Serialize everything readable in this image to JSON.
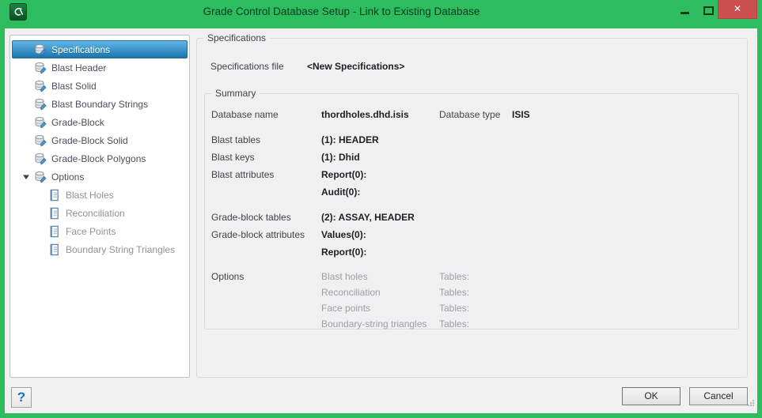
{
  "window": {
    "title": "Grade Control Database Setup - Link to Existing Database",
    "close_glyph": "✕"
  },
  "sidebar": {
    "items": [
      {
        "label": "Specifications",
        "icon": "database-edit",
        "selected": true
      },
      {
        "label": "Blast Header",
        "icon": "database-edit"
      },
      {
        "label": "Blast Solid",
        "icon": "database-edit"
      },
      {
        "label": "Blast Boundary Strings",
        "icon": "database-edit"
      },
      {
        "label": "Grade-Block",
        "icon": "database-edit"
      },
      {
        "label": "Grade-Block Solid",
        "icon": "database-edit"
      },
      {
        "label": "Grade-Block Polygons",
        "icon": "database-edit"
      },
      {
        "label": "Options",
        "icon": "database-edit",
        "expanded": true
      },
      {
        "label": "Blast Holes",
        "icon": "document",
        "child": true
      },
      {
        "label": "Reconciliation",
        "icon": "document",
        "child": true
      },
      {
        "label": "Face Points",
        "icon": "document",
        "child": true
      },
      {
        "label": "Boundary String Triangles",
        "icon": "document",
        "child": true
      }
    ]
  },
  "main": {
    "group_title": "Specifications",
    "spec_file": {
      "label": "Specifications file",
      "value": "<New Specifications>"
    },
    "summary": {
      "group_title": "Summary",
      "sections": [
        [
          {
            "label": "Database name",
            "value": "thordholes.dhd.isis",
            "value_style": "bold",
            "right_label": "Database type",
            "right_value": "ISIS"
          }
        ],
        [
          {
            "label": "Blast tables",
            "value": "(1): HEADER",
            "value_style": "bold"
          },
          {
            "label": "Blast keys",
            "value": "(1): Dhid",
            "value_style": "bold"
          },
          {
            "label": "Blast attributes",
            "value": "Report(0):",
            "value_style": "bold"
          },
          {
            "label": "",
            "value": "Audit(0):",
            "value_style": "bold"
          }
        ],
        [
          {
            "label": "Grade-block tables",
            "value": "(2): ASSAY, HEADER",
            "value_style": "bold"
          },
          {
            "label": "Grade-block attributes",
            "value": "Values(0):",
            "value_style": "bold"
          },
          {
            "label": "",
            "value": "Report(0):",
            "value_style": "bold"
          }
        ],
        [
          {
            "label": "Options",
            "value": "Blast holes",
            "value_style": "gray",
            "right_label": "Tables:"
          },
          {
            "label": "",
            "value": "Reconciliation",
            "value_style": "gray",
            "right_label": "Tables:"
          },
          {
            "label": "",
            "value": "Face points",
            "value_style": "gray",
            "right_label": "Tables:"
          },
          {
            "label": "",
            "value": "Boundary-string triangles",
            "value_style": "gray",
            "right_label": "Tables:"
          }
        ]
      ]
    }
  },
  "footer": {
    "help_label": "?",
    "ok_label": "OK",
    "cancel_label": "Cancel"
  },
  "colors": {
    "titlebar_green": "#2dbd5f",
    "close_red": "#cb4f4f",
    "selection_blue_top": "#62b5e5",
    "selection_blue_bottom": "#1e74a8"
  }
}
